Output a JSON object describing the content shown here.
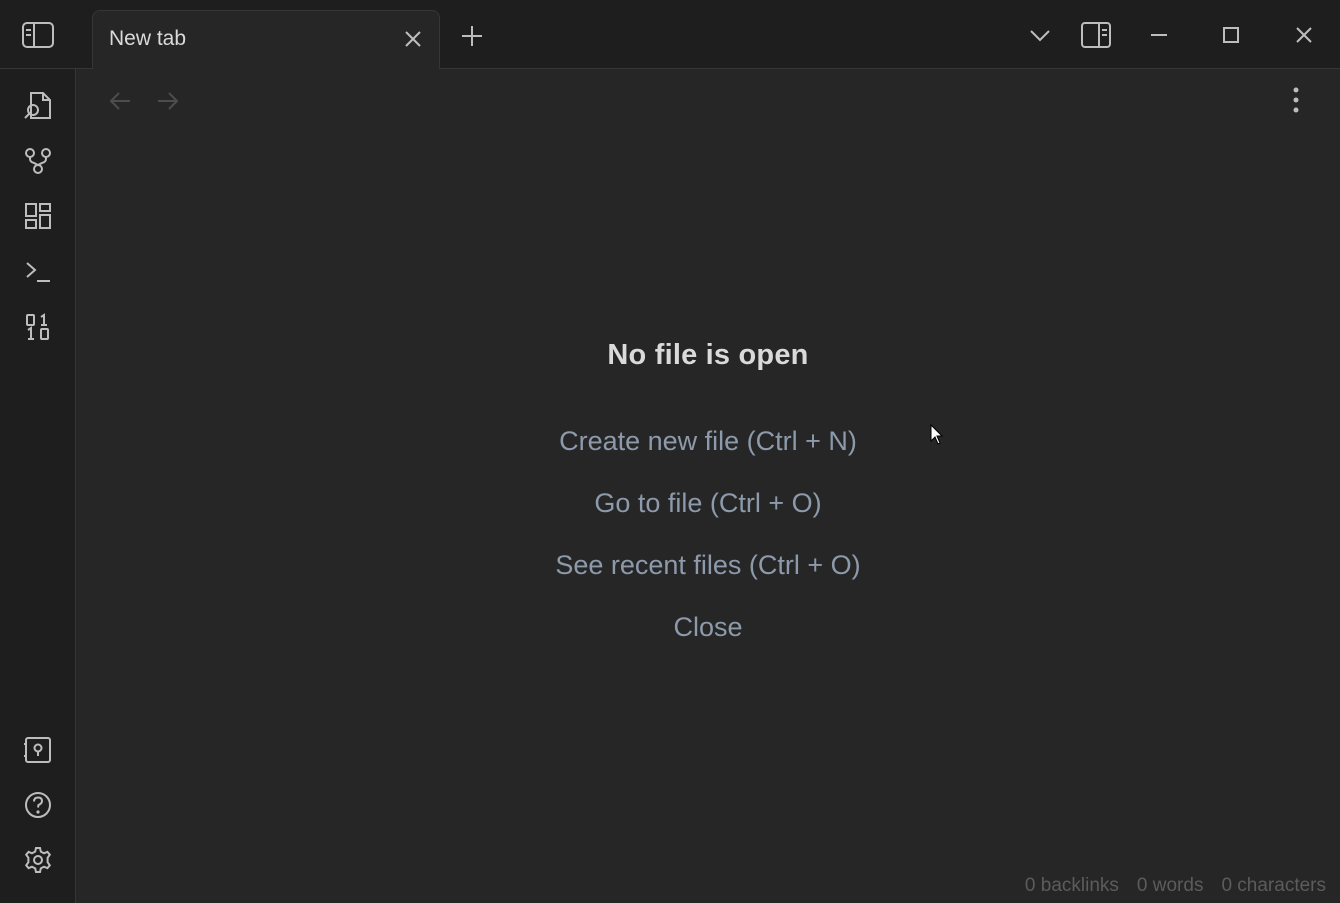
{
  "tabs": [
    {
      "label": "New tab",
      "active": true
    }
  ],
  "empty_state": {
    "title": "No file is open",
    "actions": [
      {
        "label": "Create new file (Ctrl + N)"
      },
      {
        "label": "Go to file (Ctrl + O)"
      },
      {
        "label": "See recent files (Ctrl + O)"
      },
      {
        "label": "Close"
      }
    ]
  },
  "ribbon": {
    "top": [
      "file-search-icon",
      "git-branch-icon",
      "layout-grid-icon",
      "terminal-icon",
      "binary-icon"
    ],
    "bottom": [
      "vault-icon",
      "help-icon",
      "settings-icon"
    ]
  },
  "status_bar": {
    "backlinks": "0 backlinks",
    "words": "0 words",
    "characters": "0 characters"
  },
  "colors": {
    "background": "#262626",
    "chrome": "#1e1e1e",
    "text": "#dadada",
    "link": "#8d9aab",
    "muted": "#5c5c5c"
  }
}
